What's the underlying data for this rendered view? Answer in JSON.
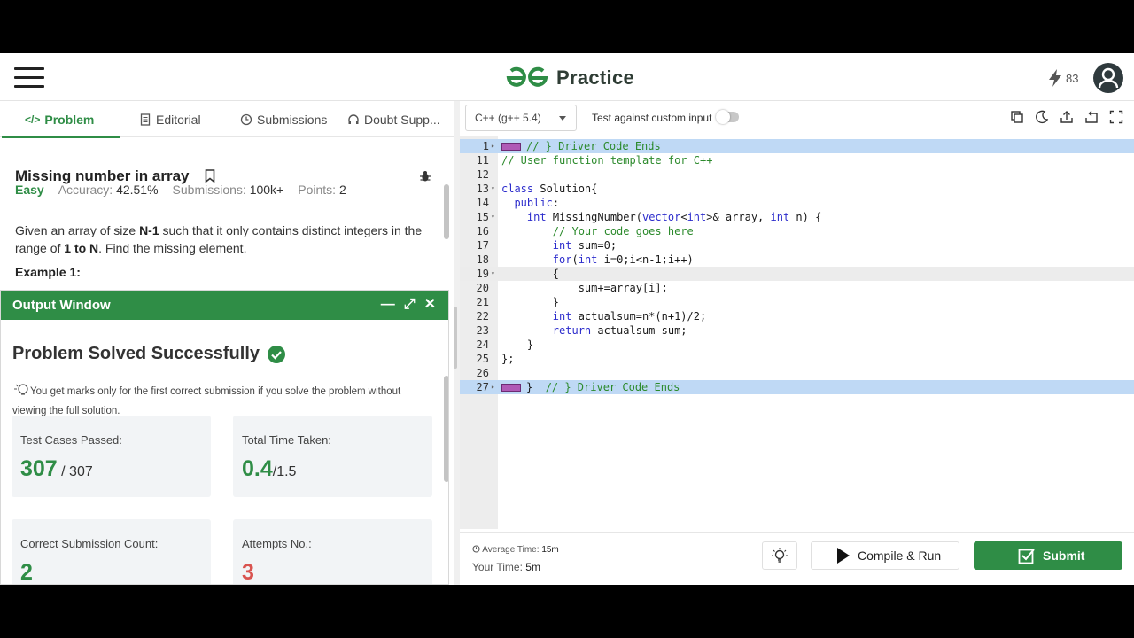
{
  "header": {
    "brand": "Practice",
    "streak_count": "83"
  },
  "tabs": [
    {
      "label": "Problem"
    },
    {
      "label": "Editorial"
    },
    {
      "label": "Submissions"
    },
    {
      "label": "Doubt Supp..."
    }
  ],
  "problem": {
    "title": "Missing number in array",
    "difficulty": "Easy",
    "accuracy_label": "Accuracy:",
    "accuracy": "42.51%",
    "submissions_label": "Submissions:",
    "submissions": "100k+",
    "points_label": "Points:",
    "points": "2",
    "desc_1": "Given an array of size ",
    "desc_b1": "N-1",
    "desc_2": " such that it only contains distinct integers in the range of ",
    "desc_b2": "1 to N",
    "desc_3": ". Find the missing element.",
    "example": "Example 1:"
  },
  "output": {
    "title": "Output Window",
    "solved": "Problem Solved Successfully",
    "tip": "You get marks only for the first correct submission if you solve the problem without viewing the full solution.",
    "cards": [
      {
        "label": "Test Cases Passed:",
        "value": "307",
        "total": " / 307"
      },
      {
        "label": "Total Time Taken:",
        "value": "0.4",
        "total": "/1.5"
      },
      {
        "label": "Correct Submission Count:",
        "value": "2",
        "total": ""
      },
      {
        "label": "Attempts No.:",
        "value": "3",
        "total": ""
      }
    ]
  },
  "editor": {
    "language": "C++ (g++ 5.4)",
    "custom_input_label": "Test against custom input",
    "lines": [
      {
        "n": "1",
        "fold": "▸",
        "hl": true,
        "cur": false,
        "tag": true,
        "code": "// } Driver Code Ends"
      },
      {
        "n": "11",
        "fold": "",
        "hl": false,
        "cur": false,
        "tag": false,
        "code": "// User function template for C++"
      },
      {
        "n": "12",
        "fold": "",
        "hl": false,
        "cur": false,
        "tag": false,
        "code": ""
      },
      {
        "n": "13",
        "fold": "▾",
        "hl": false,
        "cur": false,
        "tag": false,
        "code": "class Solution{"
      },
      {
        "n": "14",
        "fold": "",
        "hl": false,
        "cur": false,
        "tag": false,
        "code": "  public:"
      },
      {
        "n": "15",
        "fold": "▾",
        "hl": false,
        "cur": false,
        "tag": false,
        "code": "    int MissingNumber(vector<int>& array, int n) {"
      },
      {
        "n": "16",
        "fold": "",
        "hl": false,
        "cur": false,
        "tag": false,
        "code": "        // Your code goes here"
      },
      {
        "n": "17",
        "fold": "",
        "hl": false,
        "cur": false,
        "tag": false,
        "code": "        int sum=0;"
      },
      {
        "n": "18",
        "fold": "",
        "hl": false,
        "cur": false,
        "tag": false,
        "code": "        for(int i=0;i<n-1;i++)"
      },
      {
        "n": "19",
        "fold": "▾",
        "hl": false,
        "cur": true,
        "tag": false,
        "code": "        {"
      },
      {
        "n": "20",
        "fold": "",
        "hl": false,
        "cur": false,
        "tag": false,
        "code": "            sum+=array[i];"
      },
      {
        "n": "21",
        "fold": "",
        "hl": false,
        "cur": false,
        "tag": false,
        "code": "        }"
      },
      {
        "n": "22",
        "fold": "",
        "hl": false,
        "cur": false,
        "tag": false,
        "code": "        int actualsum=n*(n+1)/2;"
      },
      {
        "n": "23",
        "fold": "",
        "hl": false,
        "cur": false,
        "tag": false,
        "code": "        return actualsum-sum;"
      },
      {
        "n": "24",
        "fold": "",
        "hl": false,
        "cur": false,
        "tag": false,
        "code": "    }"
      },
      {
        "n": "25",
        "fold": "",
        "hl": false,
        "cur": false,
        "tag": false,
        "code": "};"
      },
      {
        "n": "26",
        "fold": "",
        "hl": false,
        "cur": false,
        "tag": false,
        "code": ""
      },
      {
        "n": "27",
        "fold": "▸",
        "hl": true,
        "cur": false,
        "tag": true,
        "code": "}  // } Driver Code Ends"
      }
    ]
  },
  "footer": {
    "avg_label": "Average Time:",
    "avg_value": "15m",
    "your_label": "Your Time:",
    "your_value": "5m",
    "run_label": "Compile & Run",
    "submit_label": "Submit"
  },
  "colors": {
    "brand_green": "#2f8d46",
    "highlight_blue": "#bfd9f5",
    "attempts_red": "#d9534f"
  },
  "icons": [
    "menu-icon",
    "gfg-logo-icon",
    "bolt-icon",
    "user-icon",
    "code-icon",
    "editorial-icon",
    "clock-icon",
    "headset-icon",
    "bookmark-icon",
    "bug-icon",
    "minimize-icon",
    "expand-icon",
    "close-icon",
    "check-circle-icon",
    "bulb-icon",
    "copy-icon",
    "moon-icon",
    "upload-icon",
    "reset-icon",
    "fullscreen-icon",
    "play-icon",
    "submit-check-icon"
  ]
}
